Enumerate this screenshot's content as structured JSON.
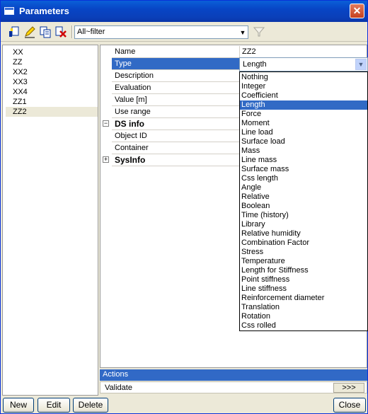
{
  "window": {
    "title": "Parameters"
  },
  "toolbar": {
    "filter_value": "All~filter",
    "buttons": [
      "new-param-icon",
      "edit-icon",
      "copy-icon",
      "delete-icon"
    ]
  },
  "parameter_list": [
    "XX",
    "ZZ",
    "XX2",
    "XX3",
    "XX4",
    "ZZ1",
    "ZZ2"
  ],
  "selected_parameter": "ZZ2",
  "properties": {
    "name": {
      "label": "Name",
      "value": "ZZ2"
    },
    "type": {
      "label": "Type",
      "value": "Length"
    },
    "description": {
      "label": "Description"
    },
    "evaluation": {
      "label": "Evaluation"
    },
    "value": {
      "label": "Value [m]"
    },
    "use_range": {
      "label": "Use range"
    },
    "ds_info": {
      "label": "DS info",
      "expander": "−"
    },
    "object_id": {
      "label": "Object ID"
    },
    "container": {
      "label": "Container"
    },
    "sysinfo": {
      "label": "SysInfo",
      "expander": "+"
    }
  },
  "type_options": [
    "Nothing",
    "Integer",
    "Coefficient",
    "Length",
    "Force",
    "Moment",
    "Line load",
    "Surface load",
    "Mass",
    "Line mass",
    "Surface mass",
    "Css length",
    "Angle",
    "Relative",
    "Boolean",
    "Time (history)",
    "Library",
    "Relative humidity",
    "Combination Factor",
    "Stress",
    "Temperature",
    "Length for Stiffness",
    "Point stiffness",
    "Line stiffness",
    "Reinforcement diameter",
    "Translation",
    "Rotation",
    "Css rolled"
  ],
  "selected_type": "Length",
  "actions": {
    "header": "Actions",
    "validate": "Validate",
    "go_label": ">>>"
  },
  "footer": {
    "new": "New",
    "edit": "Edit",
    "delete": "Delete",
    "close": "Close"
  },
  "colors": {
    "titlebar": "#0a4fcf",
    "selection": "#316ac5",
    "actions_header": "#3169c6"
  }
}
